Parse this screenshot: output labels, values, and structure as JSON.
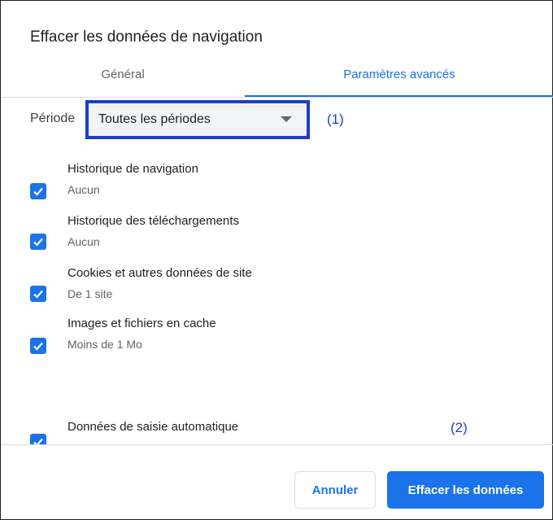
{
  "dialog": {
    "title": "Effacer les données de navigation"
  },
  "tabs": [
    {
      "label": "Général",
      "active": false
    },
    {
      "label": "Paramètres avancés",
      "active": true
    }
  ],
  "period": {
    "label": "Période",
    "selected": "Toutes les périodes"
  },
  "annotations": {
    "one": "(1)",
    "two": "(2)"
  },
  "items": [
    {
      "title": "Historique de navigation",
      "subtitle": "Aucun",
      "checked": true
    },
    {
      "title": "Historique des téléchargements",
      "subtitle": "Aucun",
      "checked": true
    },
    {
      "title": "Cookies et autres données de site",
      "subtitle": "De 1 site",
      "checked": true
    },
    {
      "title": "Images et fichiers en cache",
      "subtitle": "Moins de 1 Mo",
      "checked": true
    },
    {
      "title": "Données de saisie automatique",
      "subtitle": "",
      "checked": true
    }
  ],
  "buttons": {
    "cancel": "Annuler",
    "clear": "Effacer les données"
  },
  "colors": {
    "accent": "#1a73e8",
    "annotation": "#1a3fc7"
  }
}
